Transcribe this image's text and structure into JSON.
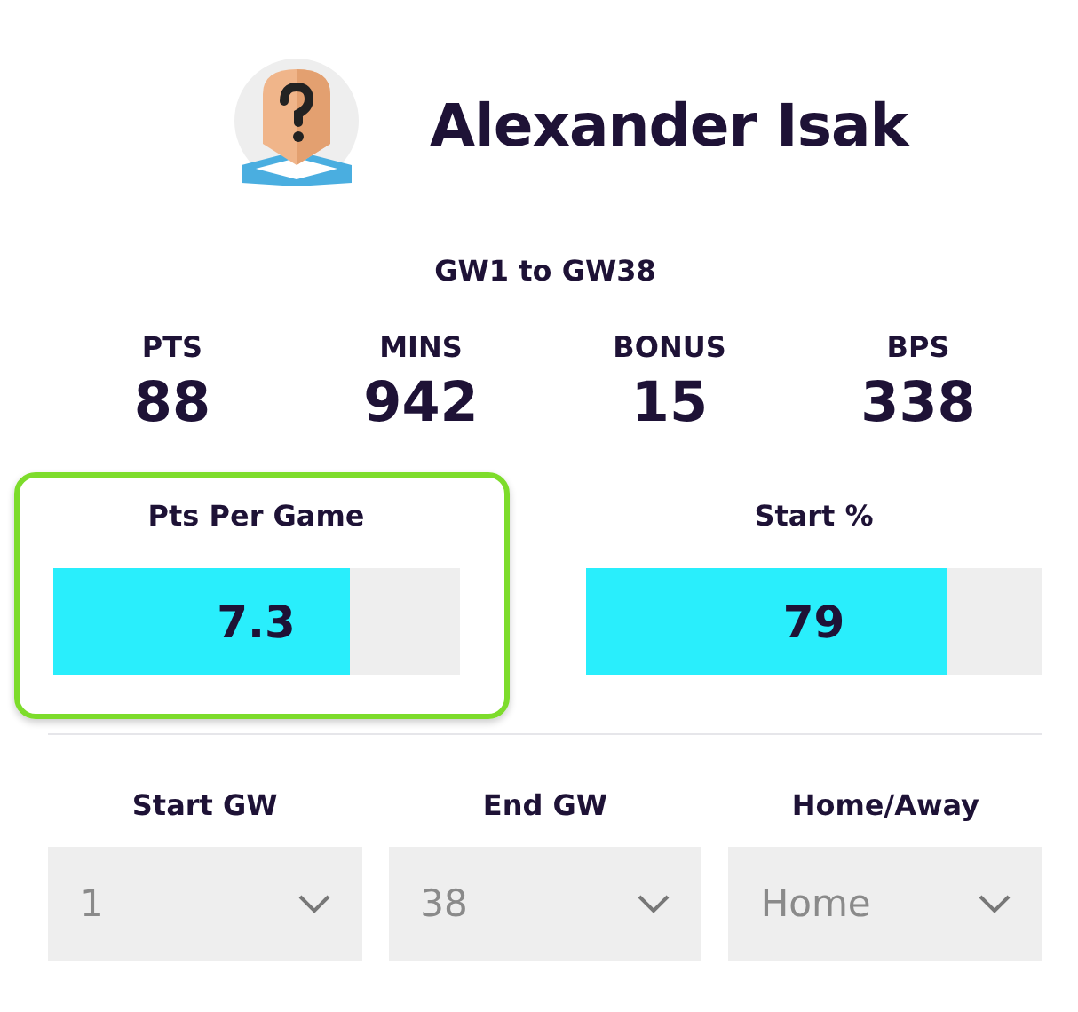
{
  "player": {
    "name": "Alexander Isak"
  },
  "range": "GW1 to GW38",
  "stats": [
    {
      "label": "PTS",
      "value": "88"
    },
    {
      "label": "MINS",
      "value": "942"
    },
    {
      "label": "BONUS",
      "value": "15"
    },
    {
      "label": "BPS",
      "value": "338"
    }
  ],
  "meters": [
    {
      "label": "Pts Per Game",
      "reading": "7.3",
      "level": 0.73,
      "selected": true
    },
    {
      "label": "Start %",
      "reading": "79",
      "level": 0.79,
      "selected": false
    }
  ],
  "filters": [
    {
      "label": "Start GW",
      "value": "1"
    },
    {
      "label": "End GW",
      "value": "38"
    },
    {
      "label": "Home/Away",
      "value": "Home"
    }
  ]
}
